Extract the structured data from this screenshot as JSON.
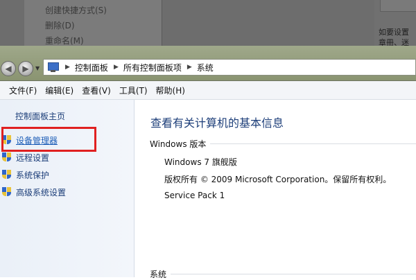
{
  "background_menu": {
    "items": [
      "创建快捷方式(S)",
      "删除(D)",
      "重命名(M)"
    ],
    "right_text_lines": [
      "如要设置",
      "章冊、迷"
    ]
  },
  "address_bar": {
    "breadcrumbs": [
      "控制面板",
      "所有控制面板项",
      "系统"
    ]
  },
  "menu_bar": {
    "items": [
      "文件(F)",
      "编辑(E)",
      "查看(V)",
      "工具(T)",
      "帮助(H)"
    ]
  },
  "sidebar": {
    "home": "控制面板主页",
    "tasks": [
      {
        "label": "设备管理器",
        "active": true
      },
      {
        "label": "远程设置",
        "active": false
      },
      {
        "label": "系统保护",
        "active": false
      },
      {
        "label": "高级系统设置",
        "active": false
      }
    ]
  },
  "main": {
    "title": "查看有关计算机的基本信息",
    "windows_section": {
      "heading": "Windows 版本",
      "edition": "Windows 7 旗舰版",
      "copyright": "版权所有 © 2009 Microsoft Corporation。保留所有权利。",
      "service_pack": "Service Pack 1"
    },
    "system_section": {
      "heading": "系统"
    }
  },
  "colors": {
    "link": "#1b3d78",
    "title": "#1e3f7a",
    "highlight": "#e02020",
    "shield_blue": "#2f66c9",
    "shield_yellow": "#e8c33a"
  },
  "icons": {
    "shield": "uac-shield-icon",
    "computer": "computer-icon"
  }
}
